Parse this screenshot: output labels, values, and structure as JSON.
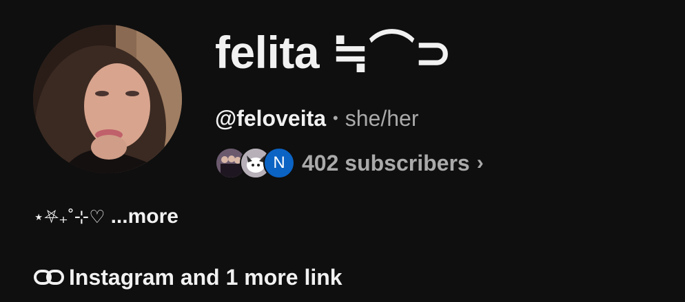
{
  "channel": {
    "name": "felita ≒⌒⊃",
    "handle": "@feloveita",
    "separator": "•",
    "pronouns": "she/her",
    "subscribers": "402 subscribers",
    "subscriber_avatar_initial": "N",
    "description": "⋆⛧₊˚⊹♡",
    "more_label": "...more",
    "links_label": "Instagram and 1 more link"
  },
  "colors": {
    "background": "#0f0f0f",
    "primary_text": "#f1f1f1",
    "secondary_text": "#aaaaaa",
    "avatar_blue": "#0b63c4"
  },
  "icons": {
    "subscribers_chevron": "chevron-right-icon",
    "links": "link-icon"
  }
}
